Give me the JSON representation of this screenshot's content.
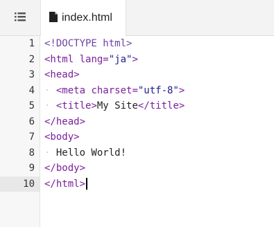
{
  "toolbar": {
    "menu_icon": "list-icon",
    "tab": {
      "label": "index.html",
      "icon": "file-icon"
    }
  },
  "editor": {
    "active_line": 10,
    "line_numbers": [
      "1",
      "2",
      "3",
      "4",
      "5",
      "6",
      "7",
      "8",
      "9",
      "10"
    ],
    "lines": [
      {
        "indent": "",
        "text": "<!DOCTYPE html>"
      },
      {
        "indent": "",
        "text": "<html lang=\"ja\">"
      },
      {
        "indent": "",
        "text": "<head>"
      },
      {
        "indent": "  ",
        "text": "<meta charset=\"utf-8\">"
      },
      {
        "indent": "  ",
        "text": "<title>My Site</title>"
      },
      {
        "indent": "",
        "text": "</head>"
      },
      {
        "indent": "",
        "text": "<body>"
      },
      {
        "indent": "  ",
        "text": "Hello World!"
      },
      {
        "indent": "",
        "text": "</body>"
      },
      {
        "indent": "",
        "text": "</html>"
      }
    ]
  }
}
